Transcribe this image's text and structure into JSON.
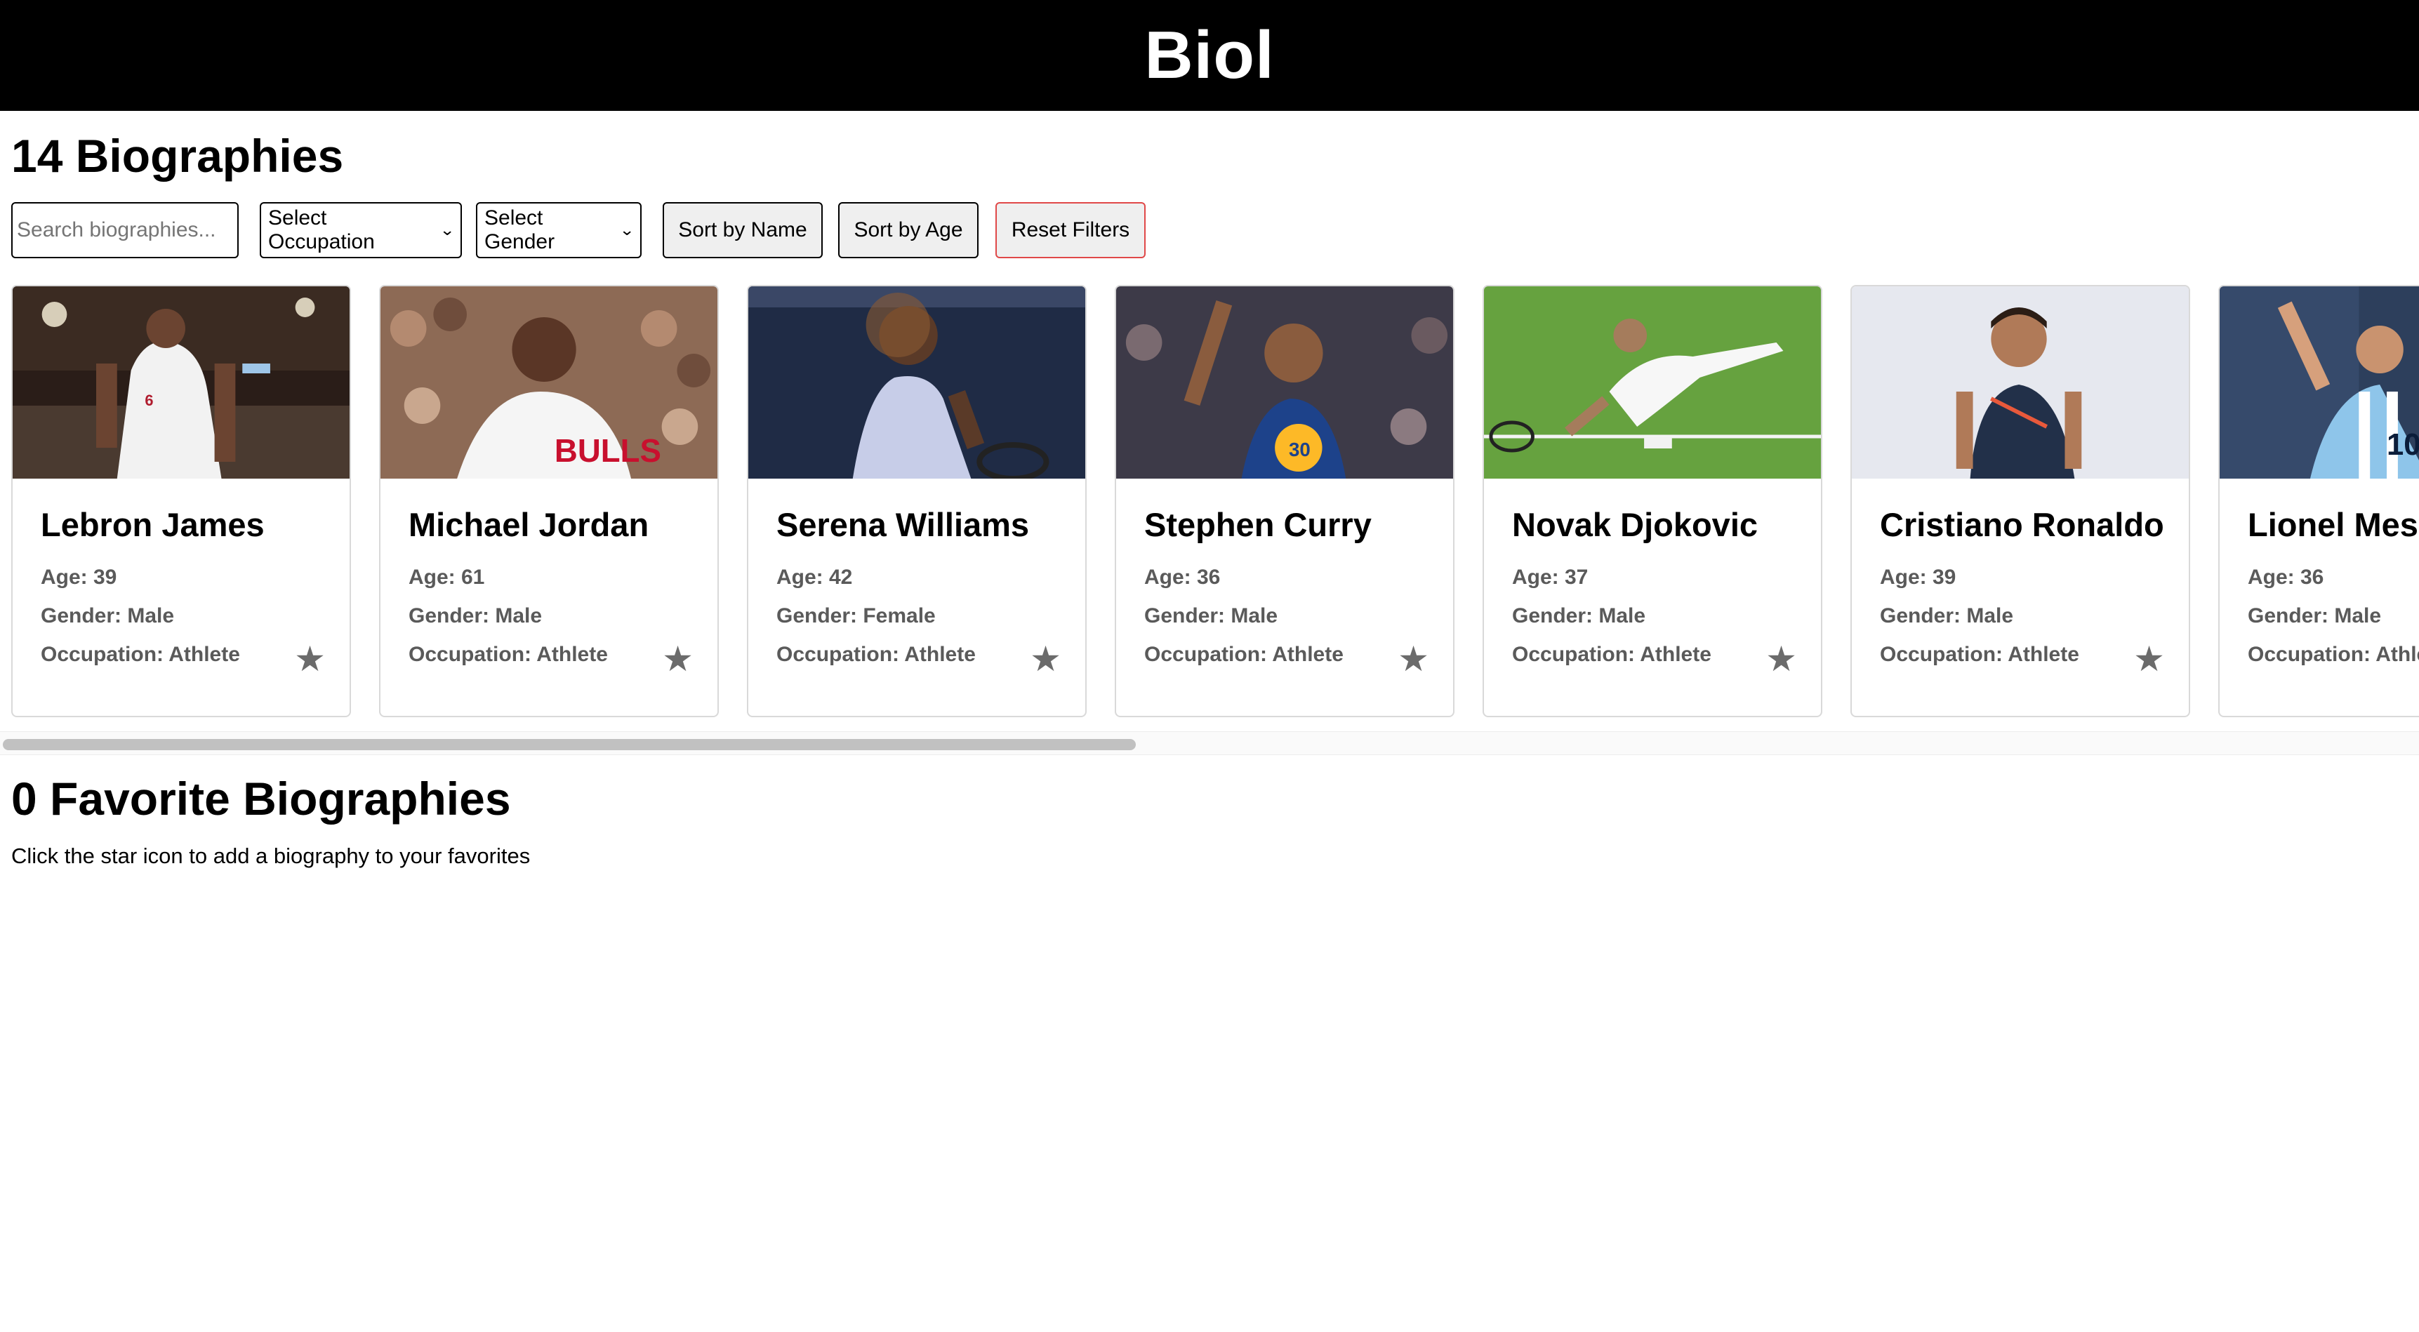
{
  "header": {
    "title": "Biol"
  },
  "biographies": {
    "count_title": "14 Biographies",
    "search_placeholder": "Search biographies...",
    "occupation_select": "Select Occupation",
    "gender_select": "Select Gender",
    "sort_name": "Sort by Name",
    "sort_age": "Sort by Age",
    "reset": "Reset Filters",
    "cards": [
      {
        "name": "Lebron James",
        "age": "Age: 39",
        "gender": "Gender: Male",
        "occupation": "Occupation: Athlete"
      },
      {
        "name": "Michael Jordan",
        "age": "Age: 61",
        "gender": "Gender: Male",
        "occupation": "Occupation: Athlete"
      },
      {
        "name": "Serena Williams",
        "age": "Age: 42",
        "gender": "Gender: Female",
        "occupation": "Occupation: Athlete"
      },
      {
        "name": "Stephen Curry",
        "age": "Age: 36",
        "gender": "Gender: Male",
        "occupation": "Occupation: Athlete"
      },
      {
        "name": "Novak Djokovic",
        "age": "Age: 37",
        "gender": "Gender: Male",
        "occupation": "Occupation: Athlete"
      },
      {
        "name": "Cristiano Ronaldo",
        "age": "Age: 39",
        "gender": "Gender: Male",
        "occupation": "Occupation: Athlete"
      },
      {
        "name": "Lionel Messi",
        "age": "Age: 36",
        "gender": "Gender: Male",
        "occupation": "Occupation: Athlete"
      }
    ]
  },
  "favorites": {
    "title": "0 Favorite Biographies",
    "hint": "Click the star icon to add a biography to your favorites"
  },
  "icons": {
    "favorite": "star-icon",
    "dropdown": "chevron-down-icon"
  },
  "colors": {
    "header_bg": "#000000",
    "reset_border": "#e04848",
    "star": "#6b6b6b"
  }
}
